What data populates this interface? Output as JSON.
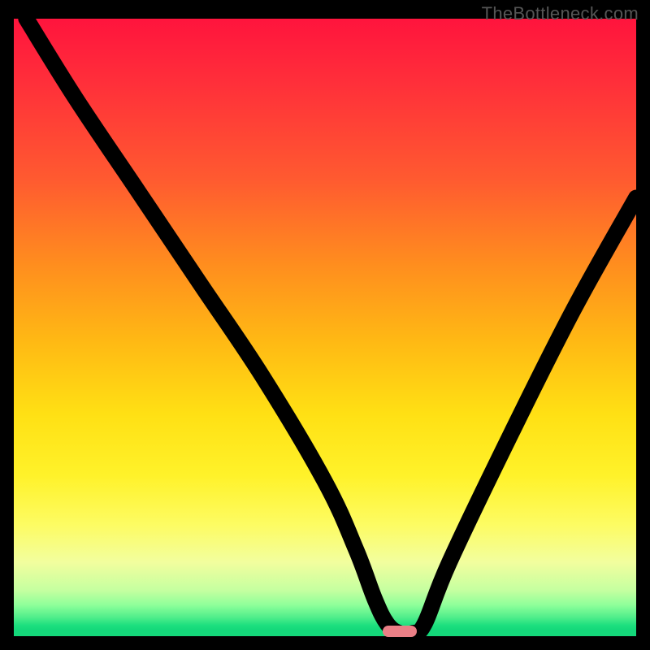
{
  "watermark": "TheBottleneck.com",
  "colors": {
    "background": "#000000",
    "marker": "#ea7f86",
    "curve": "#000000"
  },
  "chart_data": {
    "type": "line",
    "title": "",
    "xlabel": "",
    "ylabel": "",
    "xlim": [
      0,
      100
    ],
    "ylim": [
      0,
      100
    ],
    "grid": false,
    "series": [
      {
        "name": "bottleneck-curve",
        "x": [
          2,
          10,
          20,
          30,
          40,
          50,
          55,
          58,
          60,
          62,
          64,
          66,
          70,
          80,
          90,
          100
        ],
        "y": [
          100,
          87,
          72,
          57,
          42,
          25,
          14,
          6,
          2,
          0.5,
          0.5,
          2,
          12,
          33,
          53,
          71
        ]
      }
    ],
    "marker": {
      "x": 62,
      "y": 0.8
    },
    "gradient_stops": [
      {
        "pos": 0,
        "color": "#ff143d"
      },
      {
        "pos": 40,
        "color": "#ff8e1e"
      },
      {
        "pos": 74,
        "color": "#fff22a"
      },
      {
        "pos": 95,
        "color": "#8dff9a"
      },
      {
        "pos": 100,
        "color": "#14d87a"
      }
    ]
  }
}
